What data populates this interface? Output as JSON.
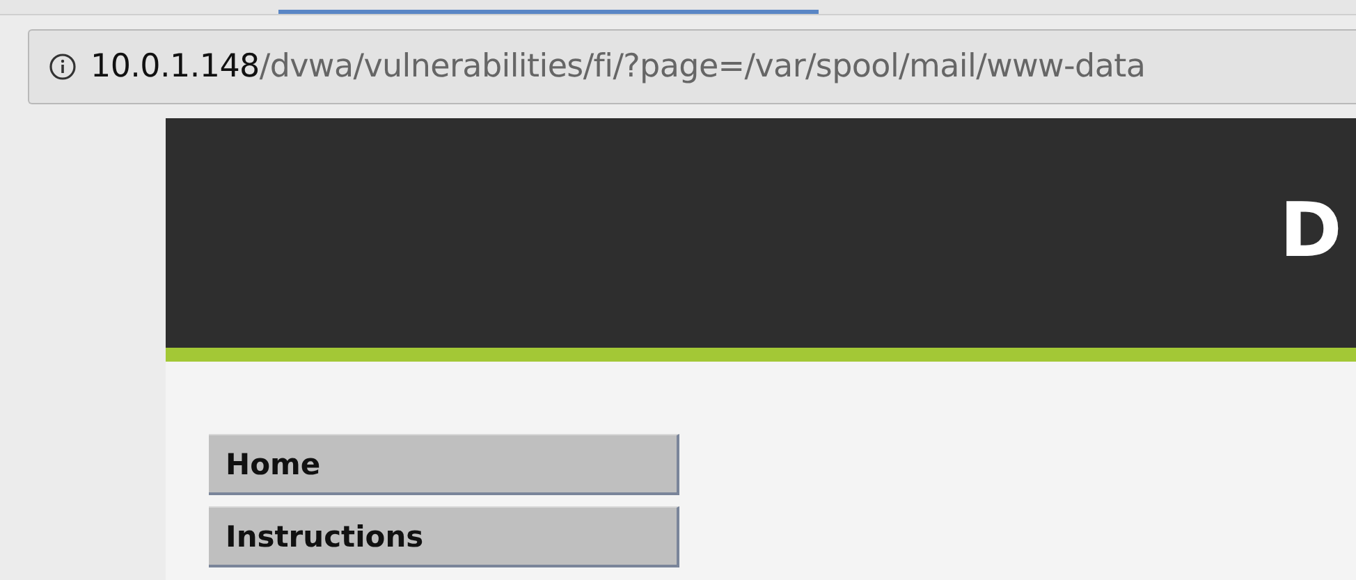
{
  "address_bar": {
    "host": "10.0.1.148",
    "path": "/dvwa/vulnerabilities/fi/?page=/var/spool/mail/www-data"
  },
  "header": {
    "logo": "D"
  },
  "menu": [
    {
      "label": "Home"
    },
    {
      "label": "Instructions"
    }
  ]
}
